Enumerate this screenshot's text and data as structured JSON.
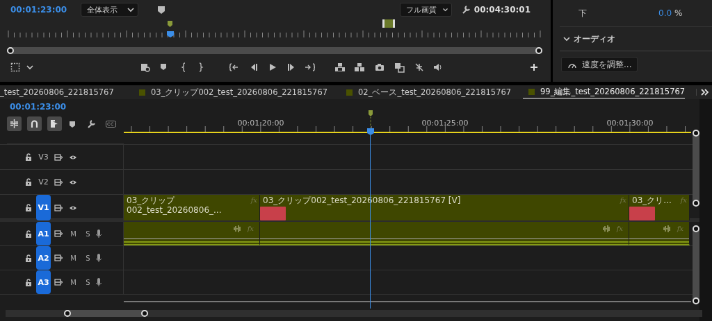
{
  "program_monitor": {
    "timecode": "00:01:23:00",
    "zoom_dropdown": "全体表示",
    "quality_dropdown": "フル画質",
    "duration": "00:04:30:01"
  },
  "effect_controls": {
    "property": {
      "label": "下",
      "value": "0.0",
      "unit": "%"
    },
    "section": {
      "label": "オーディオ",
      "expanded": true
    },
    "speed_button": "速度を調整..."
  },
  "sequence_tabs": [
    {
      "label": "_test_20260806_221815767",
      "selected": false
    },
    {
      "label": "03_クリップ002_test_20260806_221815767",
      "selected": false
    },
    {
      "label": "02_ベース_test_20260806_221815767",
      "selected": false
    },
    {
      "label": "99_編集_test_20260806_221815767",
      "selected": true
    }
  ],
  "timeline": {
    "timecode": "00:01:23:00",
    "ruler_labels": [
      "00:01:20:00",
      "00:01:25:00",
      "00:01:30:00"
    ],
    "tracks": [
      {
        "kind": "video",
        "label": "V3",
        "targeted": false
      },
      {
        "kind": "video",
        "label": "V2",
        "targeted": false
      },
      {
        "kind": "video",
        "label": "V1",
        "targeted": true,
        "clips": [
          {
            "title": "03_クリップ002_test_20260806_...",
            "badge": "fx",
            "thumbnail": false
          },
          {
            "title": "03_クリップ002_test_20260806_221815767 [V]",
            "badge": "fx",
            "thumbnail": true
          },
          {
            "title": "03_クリ...",
            "badge": "fx",
            "thumbnail": true
          }
        ]
      },
      {
        "kind": "audio",
        "label": "A1",
        "targeted": true,
        "mute": "M",
        "solo": "S",
        "clips": [
          {
            "badge": "fx"
          },
          {
            "badge": "fx"
          },
          {
            "badge": "fx"
          }
        ]
      },
      {
        "kind": "audio",
        "label": "A2",
        "targeted": true,
        "mute": "M",
        "solo": "S"
      },
      {
        "kind": "audio",
        "label": "A3",
        "targeted": true,
        "mute": "M",
        "solo": "S"
      }
    ]
  }
}
